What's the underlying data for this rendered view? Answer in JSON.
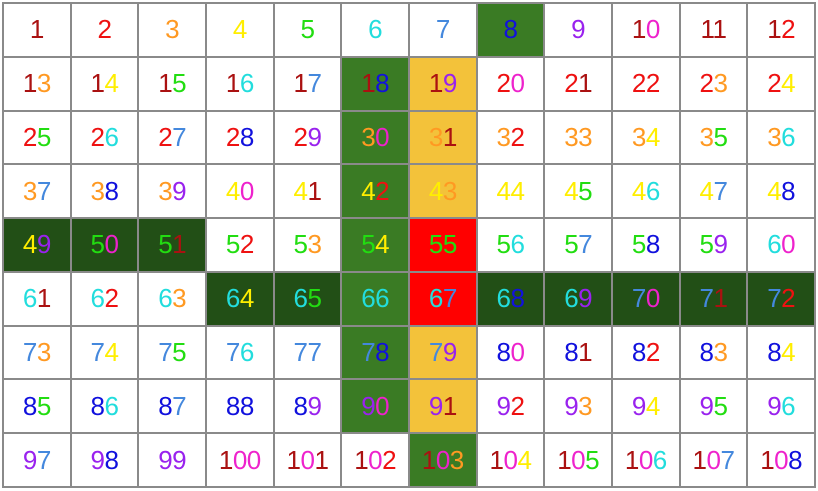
{
  "palette": {
    "dark": "#224f16",
    "green": "#3a7b24",
    "yellow": "#f3c23a",
    "red": "#ff0000",
    "white": "#ffffff"
  },
  "digit_colors": {
    "0": "#ee22cc",
    "1": "#aa1111",
    "2": "#ee1111",
    "3": "#ff9922",
    "4": "#ffee00",
    "5": "#22dd11",
    "6": "#22dddd",
    "7": "#4488dd",
    "8": "#1111dd",
    "9": "#9922ee"
  },
  "cells": [
    {
      "label": "1"
    },
    {
      "label": "2"
    },
    {
      "label": "3"
    },
    {
      "label": "4"
    },
    {
      "label": "5"
    },
    {
      "label": "6"
    },
    {
      "label": "7"
    },
    {
      "label": "8",
      "fill": "green"
    },
    {
      "label": "9"
    },
    {
      "label": "10"
    },
    {
      "label": "11"
    },
    {
      "label": "12"
    },
    {
      "label": "13"
    },
    {
      "label": "14"
    },
    {
      "label": "15"
    },
    {
      "label": "16"
    },
    {
      "label": "17"
    },
    {
      "label": "18",
      "fill": "green"
    },
    {
      "label": "19",
      "fill": "yellow"
    },
    {
      "label": "20"
    },
    {
      "label": "21"
    },
    {
      "label": "22"
    },
    {
      "label": "23"
    },
    {
      "label": "24"
    },
    {
      "label": "25"
    },
    {
      "label": "26"
    },
    {
      "label": "27"
    },
    {
      "label": "28"
    },
    {
      "label": "29"
    },
    {
      "label": "30",
      "fill": "green"
    },
    {
      "label": "31",
      "fill": "yellow"
    },
    {
      "label": "32"
    },
    {
      "label": "33"
    },
    {
      "label": "34"
    },
    {
      "label": "35"
    },
    {
      "label": "36"
    },
    {
      "label": "37"
    },
    {
      "label": "38"
    },
    {
      "label": "39"
    },
    {
      "label": "40"
    },
    {
      "label": "41"
    },
    {
      "label": "42",
      "fill": "green"
    },
    {
      "label": "43",
      "fill": "yellow"
    },
    {
      "label": "44"
    },
    {
      "label": "45"
    },
    {
      "label": "46"
    },
    {
      "label": "47"
    },
    {
      "label": "48"
    },
    {
      "label": "49",
      "fill": "dark"
    },
    {
      "label": "50",
      "fill": "dark"
    },
    {
      "label": "51",
      "fill": "dark"
    },
    {
      "label": "52"
    },
    {
      "label": "53"
    },
    {
      "label": "54",
      "fill": "green"
    },
    {
      "label": "55",
      "fill": "red"
    },
    {
      "label": "56"
    },
    {
      "label": "57"
    },
    {
      "label": "58"
    },
    {
      "label": "59"
    },
    {
      "label": "60"
    },
    {
      "label": "61"
    },
    {
      "label": "62"
    },
    {
      "label": "63"
    },
    {
      "label": "64",
      "fill": "dark"
    },
    {
      "label": "65",
      "fill": "dark"
    },
    {
      "label": "66",
      "fill": "green"
    },
    {
      "label": "67",
      "fill": "red"
    },
    {
      "label": "68",
      "fill": "dark"
    },
    {
      "label": "69",
      "fill": "dark"
    },
    {
      "label": "70",
      "fill": "dark"
    },
    {
      "label": "71",
      "fill": "dark"
    },
    {
      "label": "72",
      "fill": "dark"
    },
    {
      "label": "73"
    },
    {
      "label": "74"
    },
    {
      "label": "75"
    },
    {
      "label": "76"
    },
    {
      "label": "77"
    },
    {
      "label": "78",
      "fill": "green"
    },
    {
      "label": "79",
      "fill": "yellow"
    },
    {
      "label": "80"
    },
    {
      "label": "81"
    },
    {
      "label": "82"
    },
    {
      "label": "83"
    },
    {
      "label": "84"
    },
    {
      "label": "85"
    },
    {
      "label": "86"
    },
    {
      "label": "87"
    },
    {
      "label": "88"
    },
    {
      "label": "89"
    },
    {
      "label": "90",
      "fill": "green"
    },
    {
      "label": "91",
      "fill": "yellow"
    },
    {
      "label": "92"
    },
    {
      "label": "93"
    },
    {
      "label": "94"
    },
    {
      "label": "95"
    },
    {
      "label": "96"
    },
    {
      "label": "97"
    },
    {
      "label": "98"
    },
    {
      "label": "99"
    },
    {
      "label": "100"
    },
    {
      "label": "101"
    },
    {
      "label": "102"
    },
    {
      "label": "103",
      "fill": "green"
    },
    {
      "label": "104"
    },
    {
      "label": "105"
    },
    {
      "label": "106"
    },
    {
      "label": "107"
    },
    {
      "label": "108"
    }
  ]
}
